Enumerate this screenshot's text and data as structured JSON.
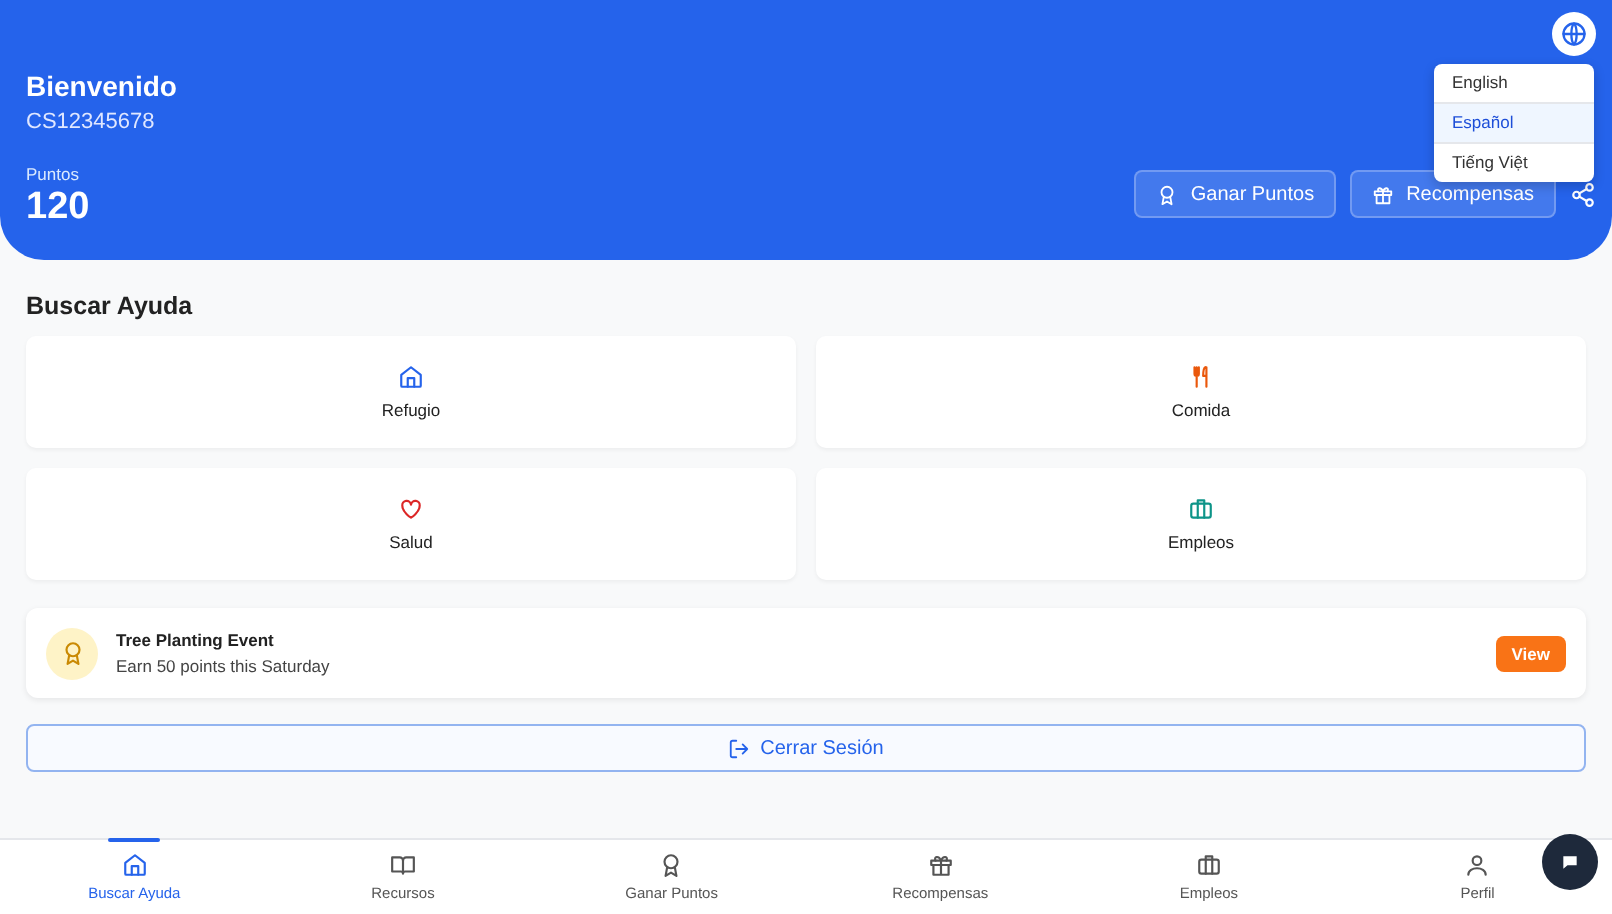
{
  "header": {
    "greeting": "Bienvenido",
    "user_id": "CS12345678",
    "points_label": "Puntos",
    "points": "120",
    "actions": [
      {
        "label": "Ganar Puntos",
        "kind": "award"
      },
      {
        "label": "Recompensas",
        "kind": "gift"
      }
    ]
  },
  "language_menu": {
    "expanded": true,
    "options": [
      {
        "label": "English",
        "selected": false
      },
      {
        "label": "Español",
        "selected": true
      },
      {
        "label": "Tiếng Việt",
        "selected": false
      }
    ]
  },
  "section_title": "Buscar Ayuda",
  "categories": [
    {
      "label": "Refugio",
      "kind": "home",
      "color": "#2563eb"
    },
    {
      "label": "Comida",
      "kind": "food",
      "color": "#ea580c"
    },
    {
      "label": "Salud",
      "kind": "heart",
      "color": "#dc2626"
    },
    {
      "label": "Empleos",
      "kind": "briefcase",
      "color": "#0d9488"
    }
  ],
  "event": {
    "title": "Tree Planting Event",
    "subtitle": "Earn 50 points this Saturday",
    "button": "View"
  },
  "logout": "Cerrar Sesión",
  "nav": [
    {
      "label": "Buscar Ayuda",
      "kind": "home",
      "selected": true
    },
    {
      "label": "Recursos",
      "kind": "book",
      "selected": false
    },
    {
      "label": "Ganar Puntos",
      "kind": "award",
      "selected": false
    },
    {
      "label": "Recompensas",
      "kind": "gift",
      "selected": false
    },
    {
      "label": "Empleos",
      "kind": "briefcase",
      "selected": false
    },
    {
      "label": "Perfil",
      "kind": "user",
      "selected": false
    }
  ]
}
